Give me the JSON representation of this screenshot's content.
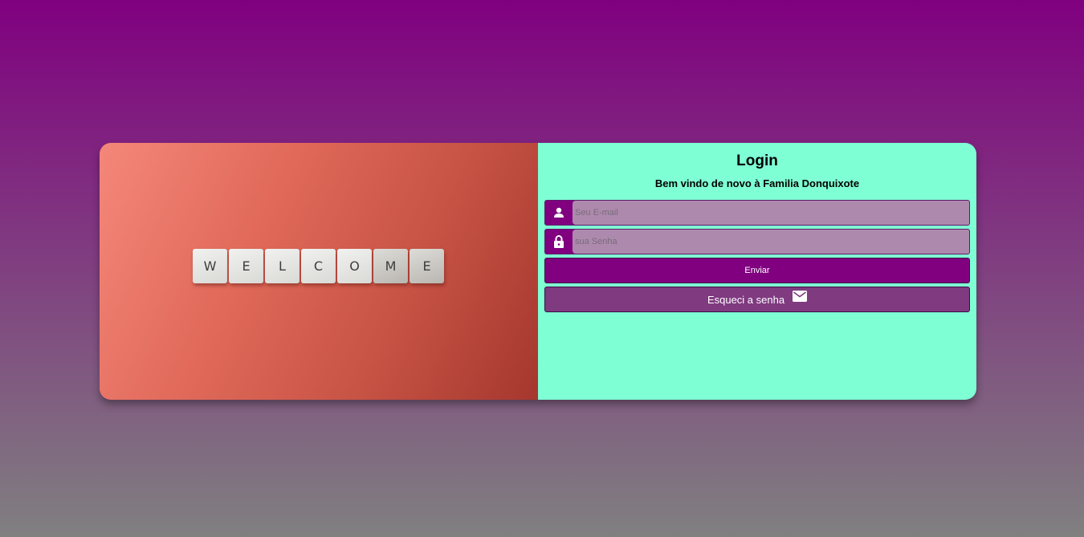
{
  "hero": {
    "tiles": [
      "W",
      "E",
      "L",
      "C",
      "O",
      "M",
      "E"
    ]
  },
  "login": {
    "title": "Login",
    "subtitle": "Bem vindo de novo à Familia Donquixote",
    "email": {
      "placeholder": "Seu E-mail",
      "value": "",
      "icon": "user-icon"
    },
    "password": {
      "placeholder": "sua Senha",
      "value": "",
      "icon": "lock-icon"
    },
    "submit_label": "Enviar",
    "forgot_label": "Esqueci a senha",
    "forgot_icon": "mail-icon"
  },
  "colors": {
    "accent": "#800080",
    "panel": "#7fffd4",
    "forgot_button": "#7f3a80",
    "input_bg": "#ad8aad"
  }
}
